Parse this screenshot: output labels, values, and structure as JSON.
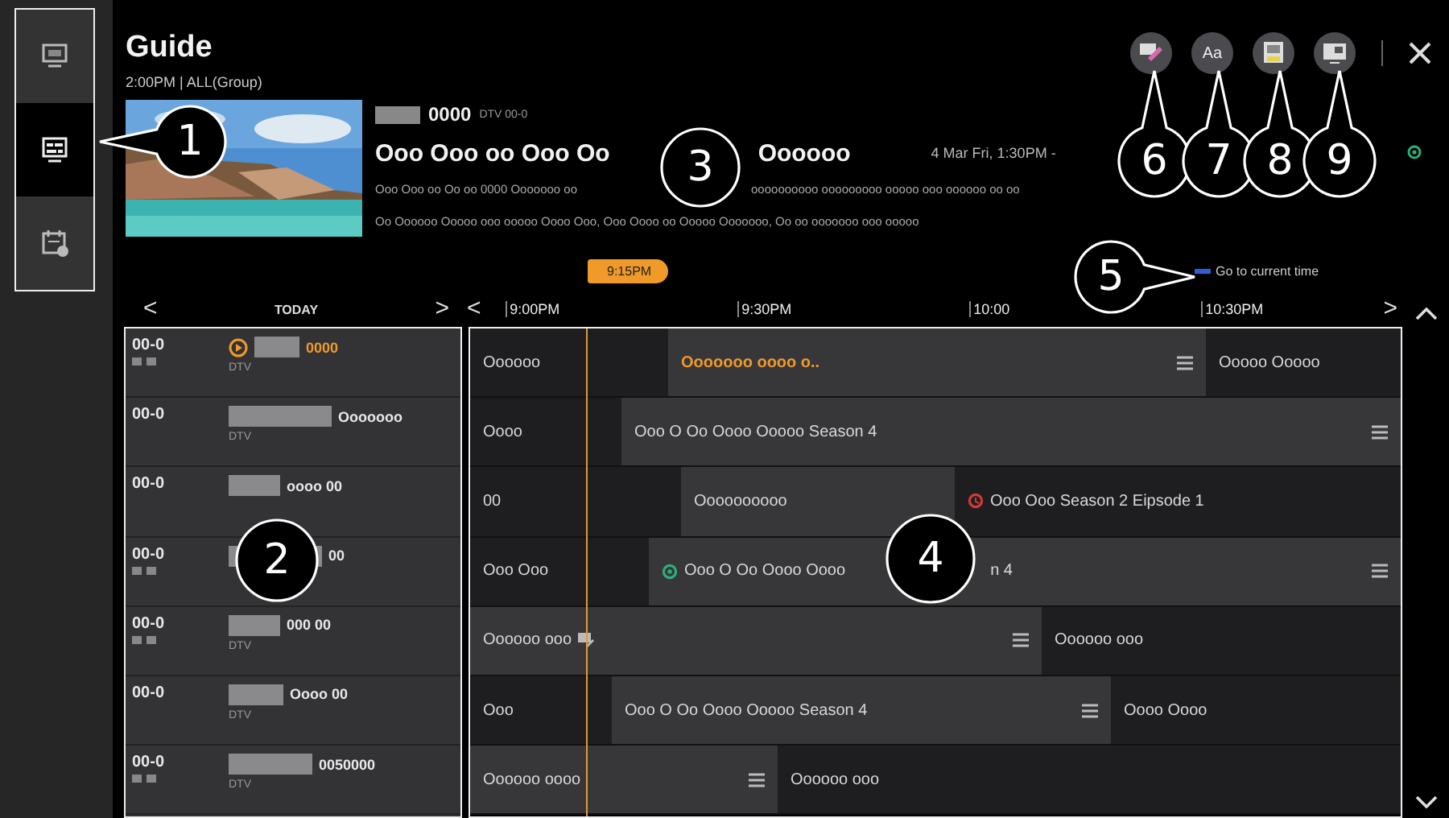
{
  "rail": [
    {
      "kind": "tv",
      "selected": false
    },
    {
      "kind": "guide",
      "selected": true
    },
    {
      "kind": "schedule",
      "selected": false
    }
  ],
  "header": {
    "title": "Guide",
    "subtitle": "2:00PM | ALL(Group)",
    "tools": [
      {
        "kind": "edit"
      },
      {
        "kind": "font",
        "label": "Aa"
      },
      {
        "kind": "recordings"
      },
      {
        "kind": "channel"
      }
    ]
  },
  "preview": {
    "kind": "picture",
    "channel_number": "0000",
    "channel_info": "DTV 00-0",
    "title_parts": [
      "Ooo Ooo oo Ooo Oo",
      "Oooooo"
    ],
    "time": "4 Mar Fri, 1:30PM -",
    "description": [
      "Ooo Ooo oo Oo oo 0000 Ooooooo oo",
      "oooooooooo ooooooooo ooooo ooo oooooo oo oo",
      "Oo Oooooo Ooooo ooo ooooo Oooo Ooo, Ooo Oooo oo Ooooo Ooooooo, Oo oo ooooooo ooo ooooo"
    ]
  },
  "date_nav": {
    "prev": "<",
    "label": "TODAY",
    "next": ">"
  },
  "timeline": {
    "prev": "<",
    "times": [
      "9:00PM",
      "9:30PM",
      "10:00",
      "10:30PM"
    ],
    "next": ">",
    "now": "9:15PM",
    "current_time_link": "Go to current time"
  },
  "channels": [
    {
      "number": "00-0",
      "name": "0000",
      "type": "DTV",
      "locked": true,
      "selected": true
    },
    {
      "number": "00-0",
      "name": "Ooooooo",
      "type": "DTV",
      "locked": false,
      "selected": false
    },
    {
      "number": "00-0",
      "name": "oooo 00",
      "locked": false,
      "selected": false
    },
    {
      "number": "00-0",
      "name": "00",
      "locked": true,
      "selected": false
    },
    {
      "number": "00-0",
      "name": "000 00",
      "type": "DTV",
      "locked": true,
      "selected": false
    },
    {
      "number": "00-0",
      "name": "Oooo 00",
      "type": "DTV",
      "locked": false,
      "selected": false
    },
    {
      "number": "00-0",
      "name": "0050000",
      "type": "DTV",
      "locked": true,
      "selected": false
    }
  ],
  "programs": [
    [
      {
        "title": "Oooooo",
        "kind": "plain",
        "aired": true,
        "menu": false,
        "selected": false
      },
      {
        "title": "Ooooooo oooo o..",
        "kind": "plain",
        "aired": false,
        "menu": true,
        "selected": true
      },
      {
        "title": "Ooooo Ooooo",
        "kind": "plain",
        "aired": true,
        "menu": false,
        "selected": false
      }
    ],
    [
      {
        "title": "Oooo",
        "kind": "plain",
        "aired": true,
        "menu": false,
        "selected": false
      },
      {
        "title": "Ooo O Oo Oooo Ooooo  Season 4",
        "kind": "plain",
        "aired": false,
        "menu": true,
        "selected": false
      }
    ],
    [
      {
        "title": "00",
        "kind": "plain",
        "aired": true,
        "menu": false,
        "selected": false
      },
      {
        "title": "Oooooooooo",
        "kind": "plain",
        "aired": false,
        "menu": false,
        "selected": false
      },
      {
        "title": "Ooo Ooo  Season 2 Eipsode 1",
        "kind": "reminder",
        "aired": true,
        "menu": false,
        "selected": false
      }
    ],
    [
      {
        "title": "Ooo Ooo",
        "kind": "plain",
        "aired": true,
        "menu": false,
        "selected": false
      },
      {
        "title": "Ooo O Oo Oooo Oooo",
        "tail": "n 4",
        "kind": "record",
        "aired": false,
        "menu": true,
        "selected": false
      }
    ],
    [
      {
        "title": "Oooooo ooo",
        "kind": "edit",
        "aired": false,
        "menu": true,
        "selected": false
      },
      {
        "title": "Oooooo ooo",
        "kind": "plain",
        "aired": true,
        "menu": false,
        "selected": false
      }
    ],
    [
      {
        "title": "Ooo",
        "kind": "plain",
        "aired": true,
        "menu": false,
        "selected": false
      },
      {
        "title": "Ooo O Oo Oooo Ooooo Season 4",
        "kind": "plain",
        "aired": false,
        "menu": true,
        "selected": false
      },
      {
        "title": "Oooo Oooo",
        "kind": "plain",
        "aired": true,
        "menu": false,
        "selected": false
      }
    ],
    [
      {
        "title": "Oooooo oooo",
        "kind": "plain",
        "aired": false,
        "menu": true,
        "selected": false
      },
      {
        "title": "Oooooo ooo",
        "kind": "plain",
        "aired": true,
        "menu": false,
        "selected": false
      }
    ]
  ],
  "callouts": [
    "1",
    "2",
    "3",
    "4",
    "5",
    "6",
    "7",
    "8",
    "9"
  ]
}
